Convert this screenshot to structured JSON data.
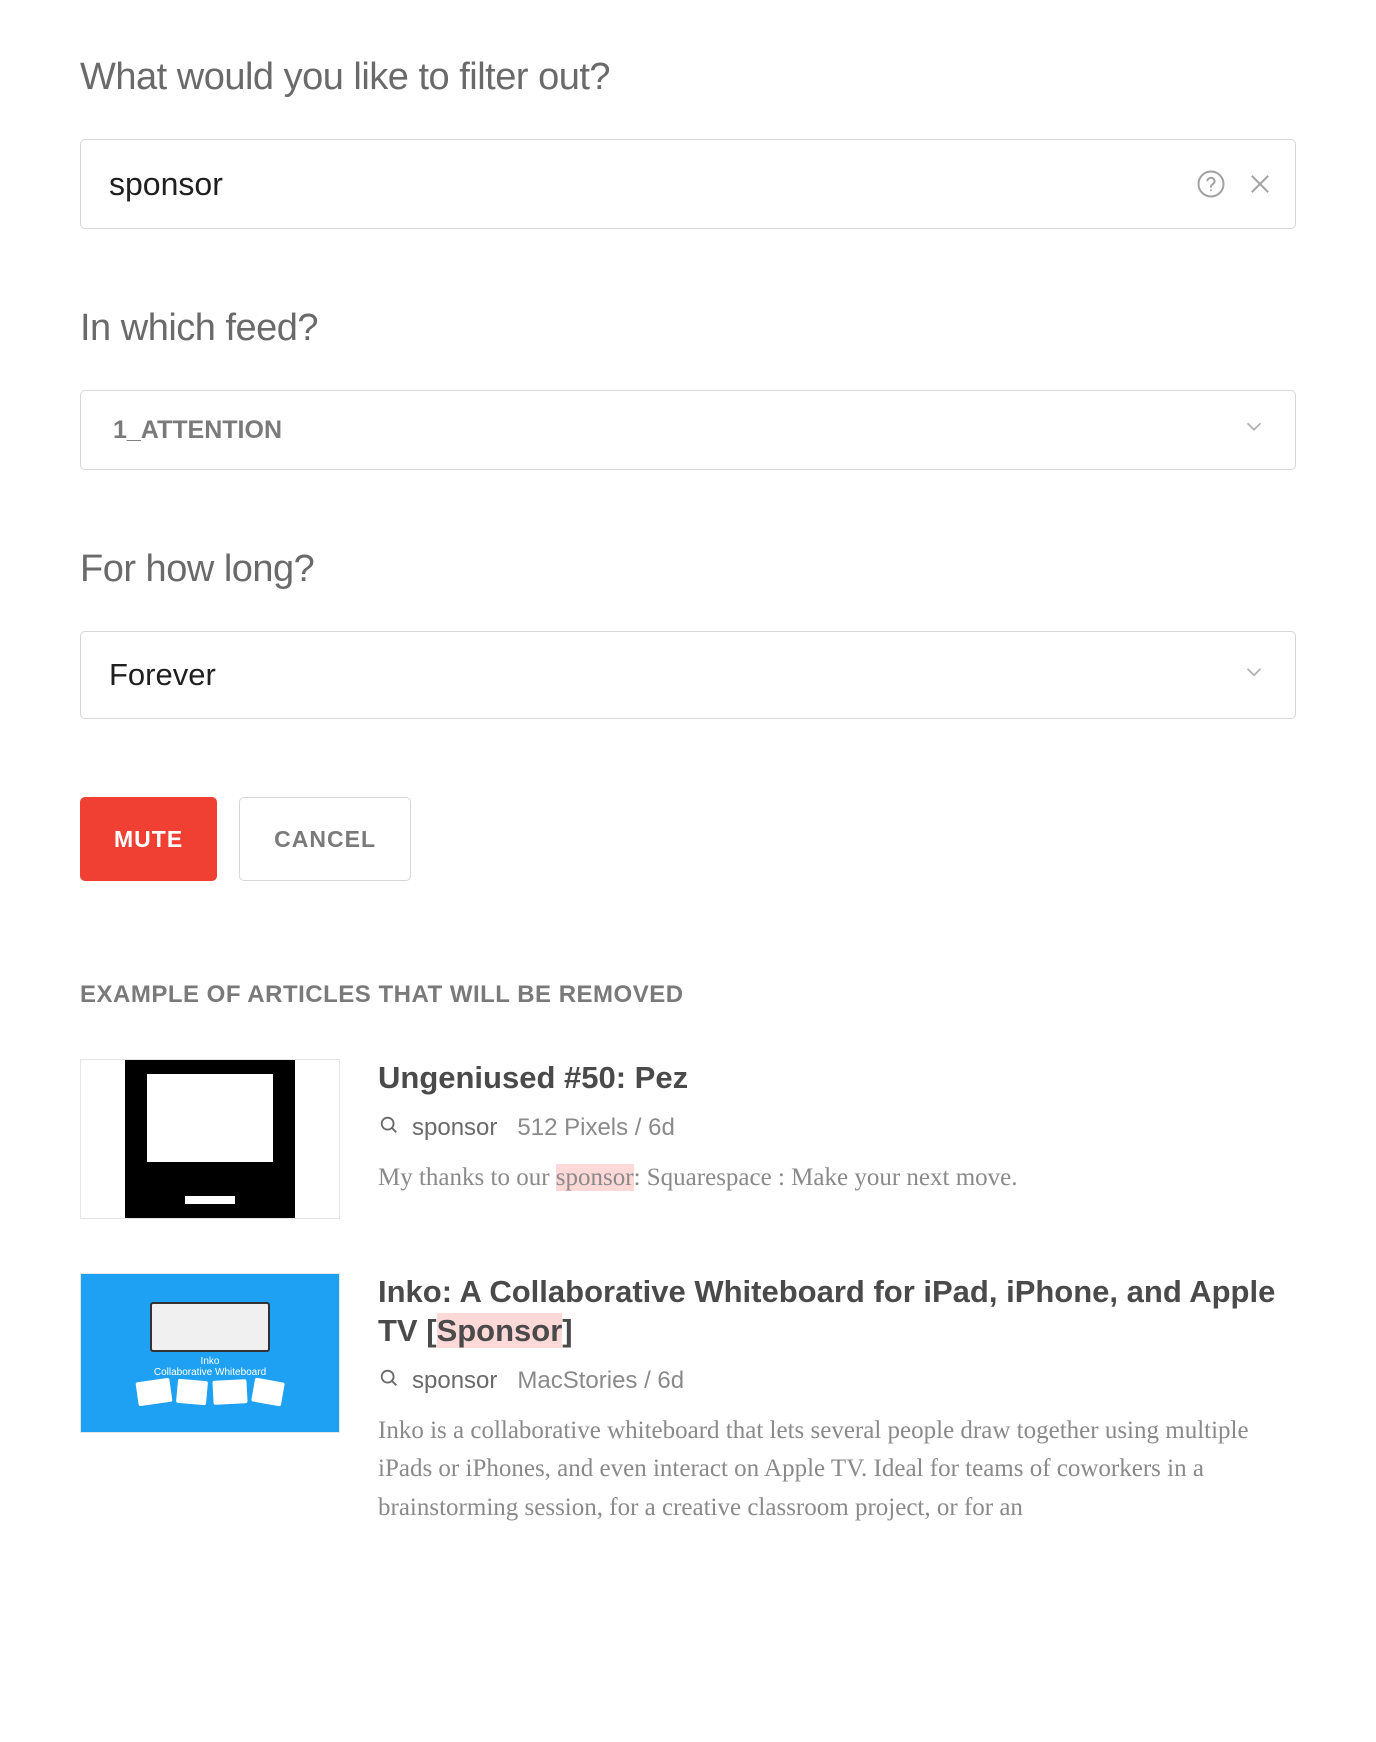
{
  "filter": {
    "label": "What would you like to filter out?",
    "value": "sponsor"
  },
  "feed": {
    "label": "In which feed?",
    "selected": "1_ATTENTION"
  },
  "duration": {
    "label": "For how long?",
    "selected": "Forever"
  },
  "actions": {
    "mute": "MUTE",
    "cancel": "CANCEL"
  },
  "examples": {
    "header": "EXAMPLE OF ARTICLES THAT WILL BE REMOVED",
    "keyword": "sponsor",
    "items": [
      {
        "title": "Ungeniused #50: Pez",
        "source": "512 Pixels / 6d",
        "snippet_pre": "My thanks to our ",
        "snippet_hl": "sponsor",
        "snippet_post": ": Squarespace : Make your next move."
      },
      {
        "title_pre": "Inko: A Collaborative Whiteboard for iPad, iPhone, and Apple TV [",
        "title_hl": "Sponsor",
        "title_post": "]",
        "source": "MacStories / 6d",
        "snippet": "Inko is a collaborative whiteboard that lets several people draw together using multiple iPads or iPhones, and even interact on Apple TV. Ideal for teams of coworkers in a brainstorming session, for a creative classroom project, or for an"
      }
    ]
  }
}
